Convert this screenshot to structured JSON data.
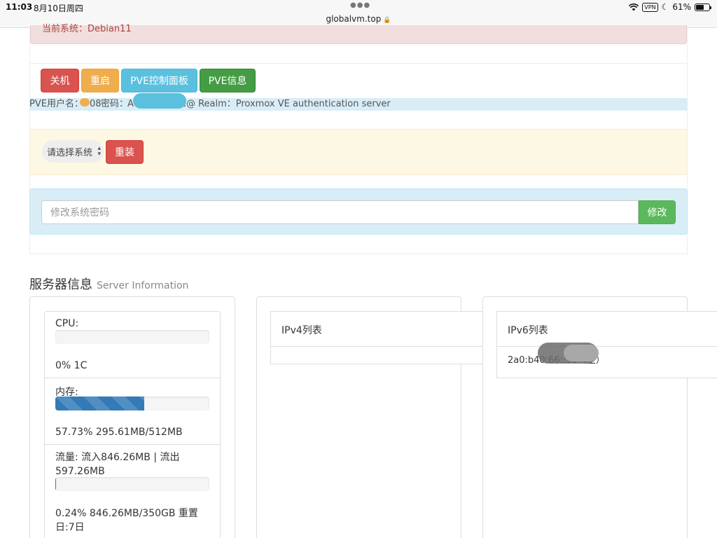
{
  "status_bar": {
    "time": "11:03",
    "date": "8月10日周四",
    "url": "globalvm.top",
    "vpn": "VPN",
    "battery": "61%",
    "battery_level": 0.61
  },
  "alert_danger": {
    "text": "当前系统：Debian11"
  },
  "buttons": {
    "shutdown": "关机",
    "reboot": "重启",
    "pve_panel": "PVE控制面板",
    "pve_info": "PVE信息"
  },
  "pve_info": {
    "username_label": "PVE用户名：",
    "username_value": "08",
    "password_label": "密码：",
    "password_value": "A",
    "realm_text": "pve@ Realm：Proxmox VE authentication server"
  },
  "reinstall": {
    "select_value": "请选择系统",
    "button": "重装"
  },
  "password_change": {
    "placeholder": "修改系统密码",
    "button": "修改"
  },
  "server_info": {
    "title": "服务器信息",
    "subtitle": "Server Information"
  },
  "stats": {
    "cpu_label": "CPU:",
    "cpu_value": "0% 1C",
    "cpu_percent": 0,
    "mem_label": "内存:",
    "mem_value": "57.73% 295.61MB/512MB",
    "mem_percent": 57.73,
    "traffic_label": "流量: 流入846.26MB | 流出597.26MB",
    "traffic_value": "0.24% 846.26MB/350GB 重置日:7日",
    "traffic_percent": 0.24
  },
  "ipv4": {
    "title": "IPv4列表"
  },
  "ipv6": {
    "title": "IPv6列表",
    "address": "2a0:b40:66::95（主）"
  }
}
